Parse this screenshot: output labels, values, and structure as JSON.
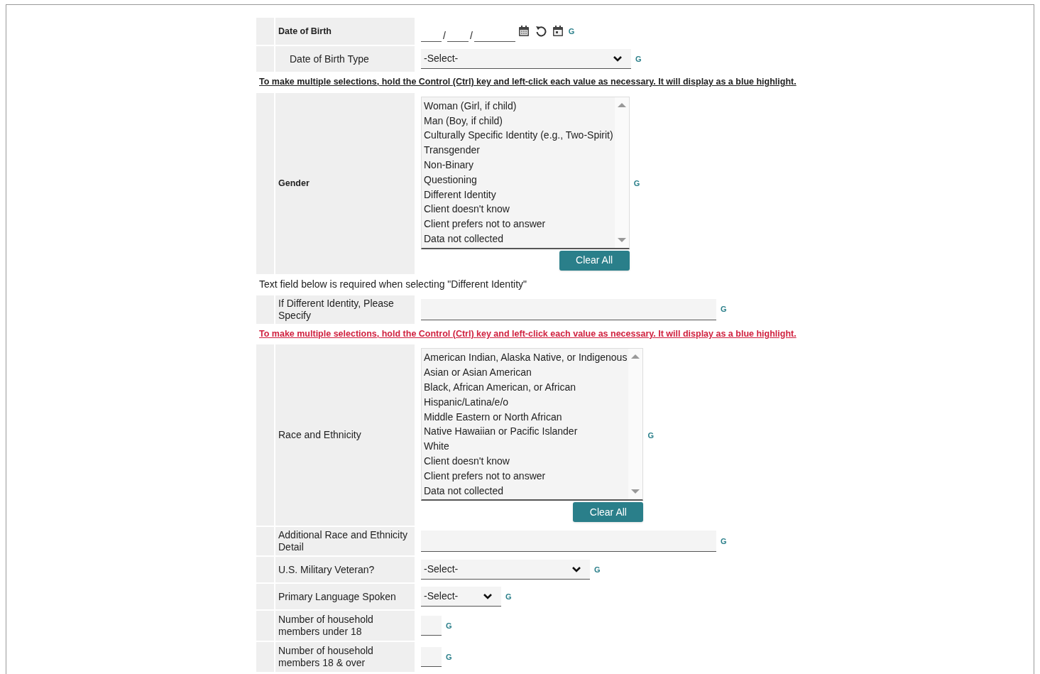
{
  "rows": [
    {
      "kind": "date",
      "label": "Date of Birth",
      "bold": true,
      "separators": [
        "/",
        "/"
      ],
      "help": "G",
      "children": [
        {
          "kind": "select",
          "label": "Date of Birth Type",
          "bold": false,
          "value": "-Select-",
          "help": "G"
        }
      ]
    },
    {
      "kind": "note",
      "text": "To make multiple selections, hold the Control (Ctrl) key and left-click each value as necessary. It will display as a blue highlight.",
      "color": "#222222"
    },
    {
      "kind": "multiselect",
      "label": "Gender",
      "bold": true,
      "options": [
        "Woman (Girl, if child)",
        "Man (Boy, if child)",
        "Culturally Specific Identity (e.g., Two-Spirit)",
        "Transgender",
        "Non-Binary",
        "Questioning",
        "Different Identity",
        "Client doesn't know",
        "Client prefers not to answer",
        "Data not collected"
      ],
      "button": "Clear All",
      "help": "G"
    },
    {
      "kind": "hint",
      "text": "Text field below is required when selecting \"Different Identity\""
    },
    {
      "kind": "text",
      "label": "If Different Identity, Please Specify",
      "bold": false,
      "help": "G"
    },
    {
      "kind": "note",
      "text": "To make multiple selections, hold the Control (Ctrl) key and left-click each value as necessary. It will display as a blue highlight.",
      "color": "#d0213f"
    },
    {
      "kind": "multiselect",
      "label": "Race and Ethnicity",
      "bold": false,
      "options": [
        "American Indian, Alaska Native, or Indigenous",
        "Asian or Asian American",
        "Black, African American, or African",
        "Hispanic/Latina/e/o",
        "Middle Eastern or North African",
        "Native Hawaiian or Pacific Islander",
        "White",
        "Client doesn't know",
        "Client prefers not to answer",
        "Data not collected"
      ],
      "button": "Clear All",
      "help": "G"
    },
    {
      "kind": "text",
      "label": "Additional Race and Ethnicity Detail",
      "bold": false,
      "help": "G"
    },
    {
      "kind": "select",
      "label": "U.S. Military Veteran?",
      "bold": false,
      "value": "-Select-",
      "help": "G"
    },
    {
      "kind": "select",
      "label": "Primary Language Spoken",
      "bold": false,
      "value": "-Select-",
      "help": "G"
    },
    {
      "kind": "number",
      "label": "Number of household members under 18",
      "bold": false,
      "help": "G"
    },
    {
      "kind": "number",
      "label": "Number of household members 18 & over",
      "bold": false,
      "help": "G"
    }
  ]
}
